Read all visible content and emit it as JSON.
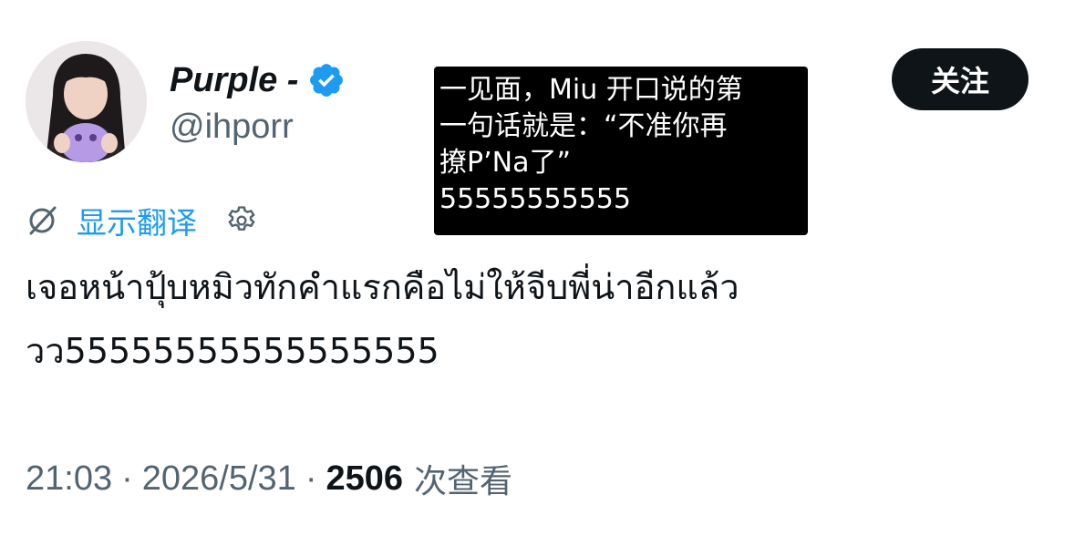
{
  "author": {
    "display_name": "Purple -",
    "handle": "@ihporr",
    "verified": true,
    "avatar_icon": "user-avatar-photo"
  },
  "follow_button": {
    "label": "关注"
  },
  "overlay": {
    "lines": [
      "一见面，Miu 开口说的第",
      "一句话就是：“不准你再",
      "撩P’Na了”",
      "55555555555"
    ]
  },
  "translate": {
    "icon": "translate-slash-icon",
    "label": "显示翻译",
    "settings_icon": "gear-icon"
  },
  "tweet": {
    "lines": [
      "เจอหน้าปุ้บหมิวทักคำแรกคือไม่ให้จีบพี่น่าอีกแล้ว",
      "วว55555555555555555"
    ]
  },
  "meta": {
    "time": "21:03",
    "date": "2026/5/31",
    "separator": "·",
    "views_count": "2506",
    "views_label": "次查看"
  },
  "colors": {
    "accent": "#1d9bf0",
    "text_primary": "#0f1419",
    "text_secondary": "#536471",
    "follow_bg": "#0f1419"
  }
}
